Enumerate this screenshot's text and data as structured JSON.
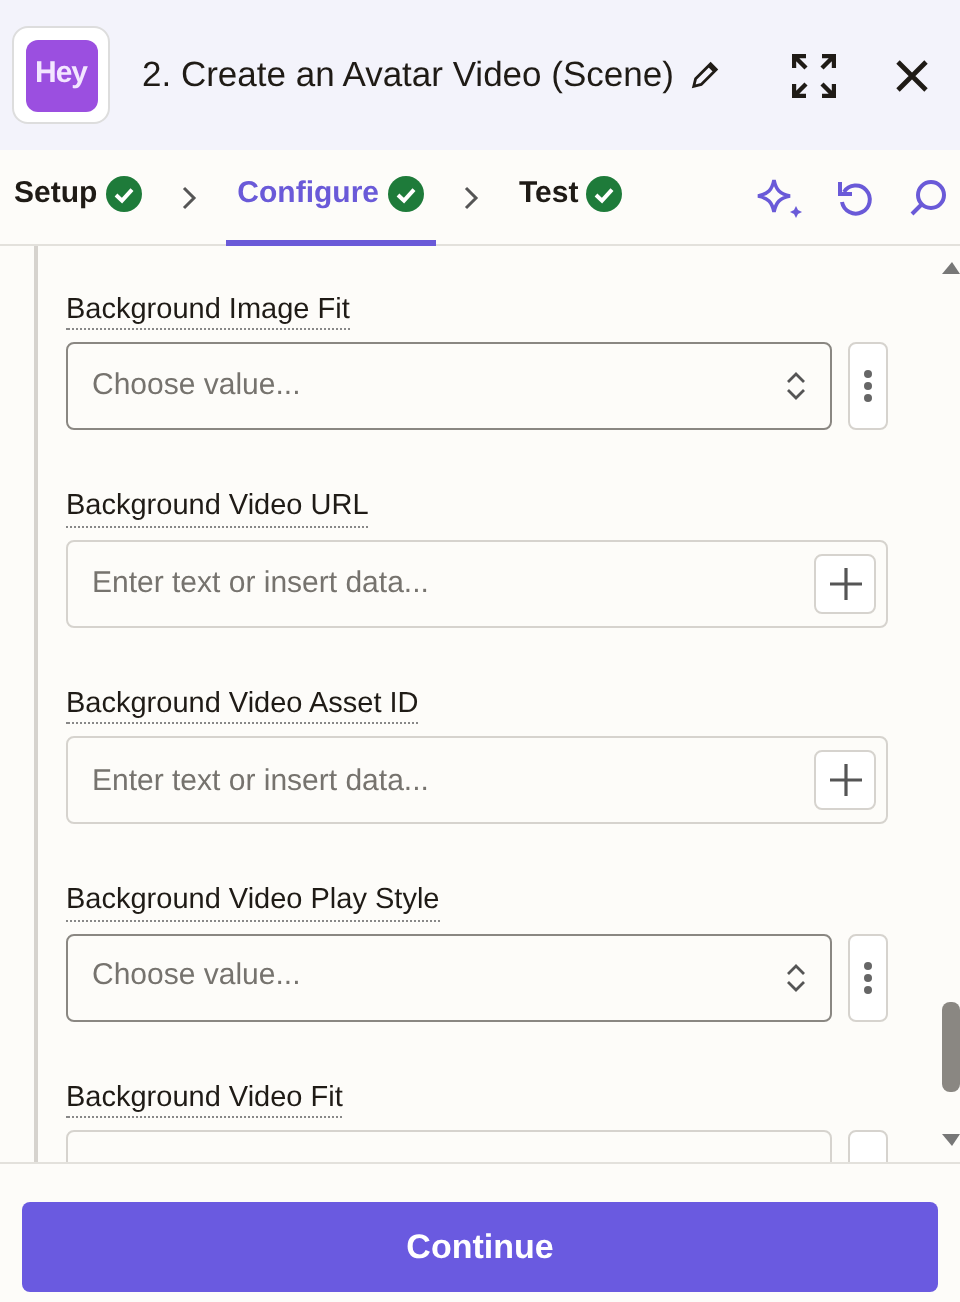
{
  "header": {
    "app_logo_text": "Hey",
    "title": "2. Create an Avatar Video (Scene)"
  },
  "steps": [
    {
      "label": "Setup",
      "selected": false,
      "completed": true
    },
    {
      "label": "Configure",
      "selected": true,
      "completed": true
    },
    {
      "label": "Test",
      "selected": false,
      "completed": true
    }
  ],
  "fields": [
    {
      "label": "Background Image Fit",
      "kind": "select",
      "placeholder": "Choose value..."
    },
    {
      "label": "Background Video URL",
      "kind": "text",
      "placeholder": "Enter text or insert data..."
    },
    {
      "label": "Background Video Asset ID",
      "kind": "text",
      "placeholder": "Enter text or insert data..."
    },
    {
      "label": "Background Video Play Style",
      "kind": "select",
      "placeholder": "Choose value..."
    },
    {
      "label": "Background Video Fit",
      "kind": "select"
    }
  ],
  "footer": {
    "button": "Continue"
  }
}
